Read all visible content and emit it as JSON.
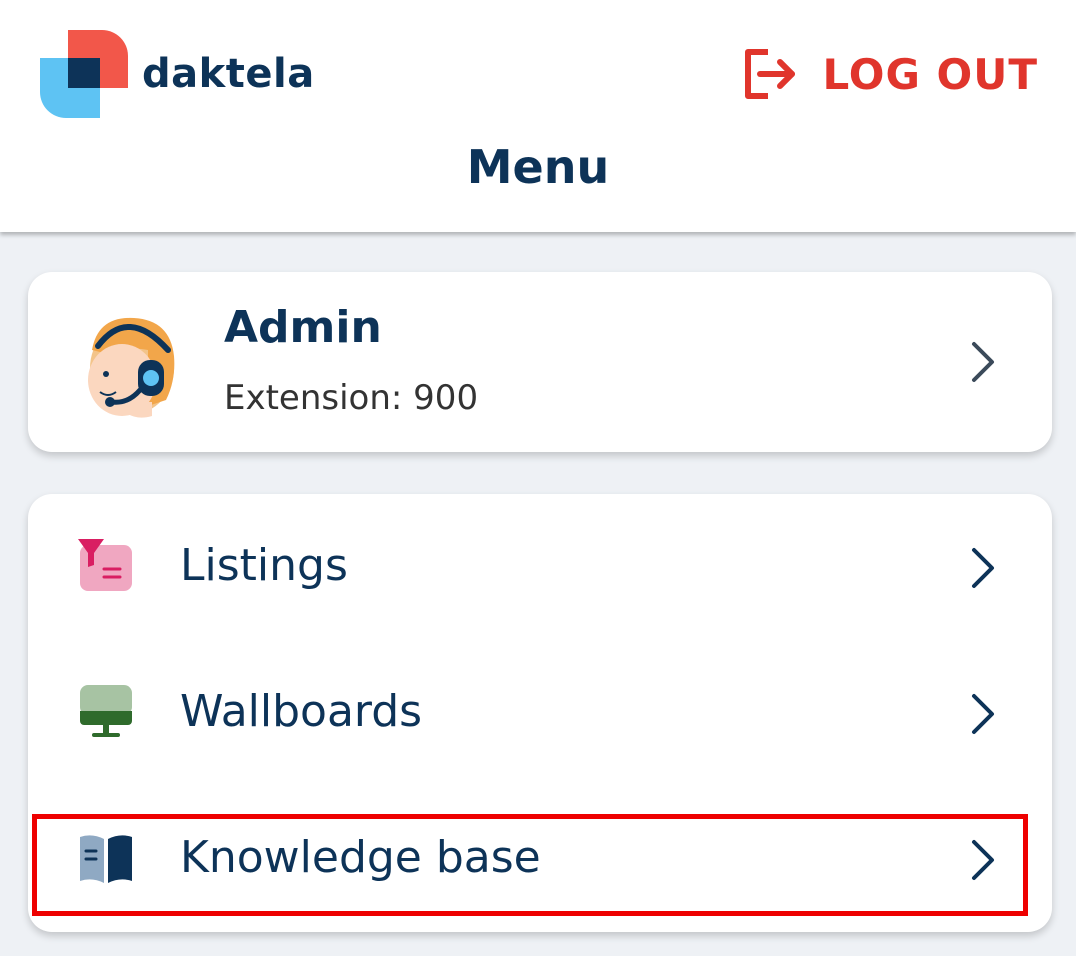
{
  "app": {
    "brand_name": "daktela",
    "logout_label": "LOG OUT",
    "page_title": "Menu",
    "accent_color": "#e0352c",
    "text_color": "#0d3358"
  },
  "profile": {
    "name": "Admin",
    "extension_text": "Extension: 900",
    "avatar_icon": "agent-headset-avatar-icon"
  },
  "menu": {
    "items": [
      {
        "label": "Listings",
        "icon": "listings-filter-icon"
      },
      {
        "label": "Wallboards",
        "icon": "wallboard-monitor-icon"
      },
      {
        "label": "Knowledge base",
        "icon": "book-icon"
      }
    ]
  }
}
